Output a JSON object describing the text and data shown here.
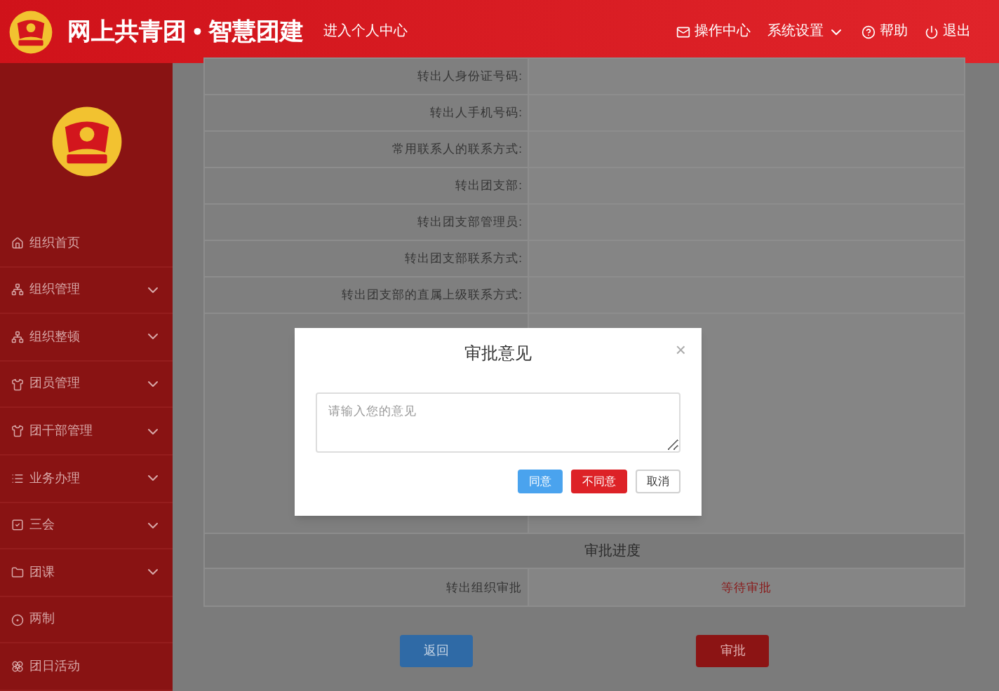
{
  "header": {
    "title": "网上共青团 • 智慧团建",
    "personal_link": "进入个人中心",
    "menu": [
      {
        "label": "操作中心",
        "has_dropdown": false
      },
      {
        "label": "系统设置",
        "has_dropdown": true
      },
      {
        "label": "帮助",
        "has_dropdown": false
      },
      {
        "label": "退出",
        "has_dropdown": false
      }
    ]
  },
  "sidebar": {
    "items": [
      {
        "label": "组织首页",
        "has_submenu": false
      },
      {
        "label": "组织管理",
        "has_submenu": true
      },
      {
        "label": "组织整顿",
        "has_submenu": true
      },
      {
        "label": "团员管理",
        "has_submenu": true
      },
      {
        "label": "团干部管理",
        "has_submenu": true
      },
      {
        "label": "业务办理",
        "has_submenu": true
      },
      {
        "label": "三会",
        "has_submenu": true
      },
      {
        "label": "团课",
        "has_submenu": true
      },
      {
        "label": "两制",
        "has_submenu": false
      },
      {
        "label": "团日活动",
        "has_submenu": false
      }
    ]
  },
  "form": {
    "rows": [
      {
        "label": "转出人身份证号码:"
      },
      {
        "label": "转出人手机号码:"
      },
      {
        "label": "常用联系人的联系方式:"
      },
      {
        "label": "转出团支部:"
      },
      {
        "label": "转出团支部管理员:"
      },
      {
        "label": "转出团支部联系方式:"
      },
      {
        "label": "转出团支部的直属上级联系方式:"
      }
    ],
    "progress_title": "审批进度",
    "progress_rows": [
      {
        "label": "转出组织审批",
        "status": "等待审批"
      }
    ],
    "buttons": [
      {
        "label": "返回",
        "kind": "primary"
      },
      {
        "label": "审批",
        "kind": "danger"
      }
    ]
  },
  "dialog": {
    "title": "审批意见",
    "close": "×",
    "comment": {
      "placeholder": "请输入您的意见"
    },
    "buttons": [
      {
        "label": "同意",
        "kind": "primary"
      },
      {
        "label": "不同意",
        "kind": "danger"
      },
      {
        "label": "取消",
        "kind": "default"
      }
    ]
  }
}
